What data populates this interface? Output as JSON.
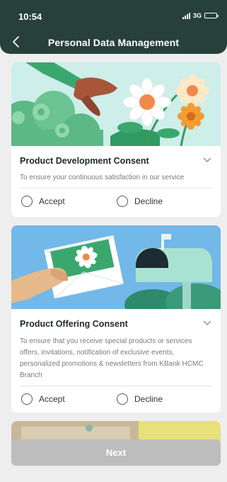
{
  "status_bar": {
    "time": "10:54",
    "network": "3G"
  },
  "header": {
    "title": "Personal Data Management"
  },
  "consents": [
    {
      "title": "Product Development Consent",
      "description": "To ensure your continuous satisfaction in our service",
      "accept_label": "Accept",
      "decline_label": "Decline"
    },
    {
      "title": "Product Offering Consent",
      "description": "To ensure that you receive special products or services offers, invitations, notification of exclusive events, personalized promotions & newsletters from KBank HCMC Branch",
      "accept_label": "Accept",
      "decline_label": "Decline"
    }
  ],
  "footer": {
    "next_label": "Next"
  },
  "colors": {
    "header": "#27403a",
    "button_disabled": "#bdbdbd",
    "banner1_bg": "#cdeee9",
    "banner2_bg": "#72b8e8"
  }
}
